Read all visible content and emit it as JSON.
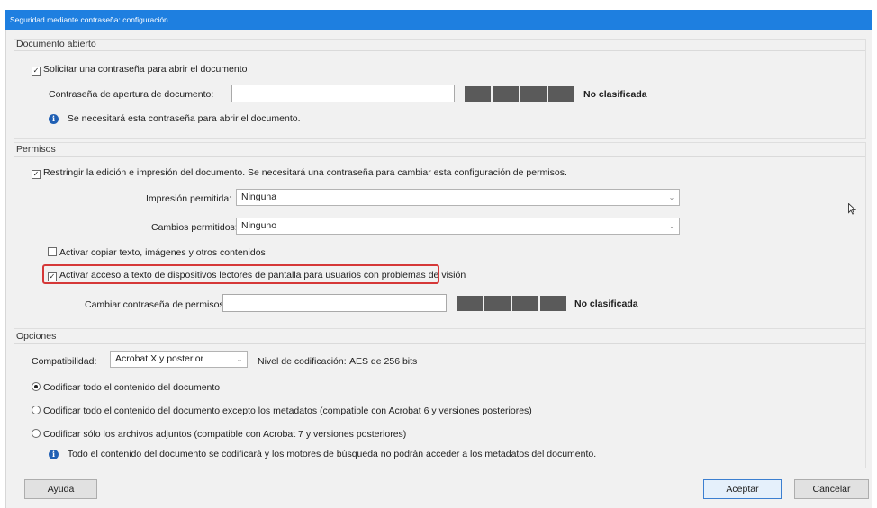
{
  "window": {
    "title": "Seguridad mediante contraseña: configuración"
  },
  "document_open": {
    "group_label": "Documento abierto",
    "require_password_label": "Solicitar una contraseña para abrir el documento",
    "require_password_checked": true,
    "password_label": "Contraseña de apertura de documento:",
    "password_value": "",
    "strength_label": "No clasificada",
    "info_text": "Se necesitará esta contraseña para abrir el documento."
  },
  "permissions": {
    "group_label": "Permisos",
    "restrict_label": "Restringir la edición e impresión del documento. Se necesitará una contraseña para cambiar esta configuración de permisos.",
    "restrict_checked": true,
    "printing_label": "Impresión permitida:",
    "printing_value": "Ninguna",
    "changes_label": "Cambios permitidos:",
    "changes_value": "Ninguno",
    "copy_label": "Activar copiar texto, imágenes y otros contenidos",
    "copy_checked": false,
    "screen_reader_label": "Activar acceso a texto de dispositivos lectores de pantalla para usuarios con problemas de visión",
    "screen_reader_checked": true,
    "change_password_label": "Cambiar contraseña de permisos:",
    "change_password_value": "",
    "strength_label": "No clasificada"
  },
  "options": {
    "group_label": "Opciones",
    "compat_label": "Compatibilidad:",
    "compat_value": "Acrobat X y posterior",
    "encryption_label": "Nivel de codificación:",
    "encryption_value": "AES de 256 bits",
    "radio_all": "Codificar todo el contenido del documento",
    "radio_except_metadata": "Codificar todo el contenido del documento excepto los metadatos (compatible con Acrobat 6 y versiones posteriores)",
    "radio_attachments": "Codificar sólo los archivos adjuntos (compatible con Acrobat 7 y versiones posteriores)",
    "selected": "radio_all",
    "info_text": "Todo el contenido del documento se codificará y los motores de búsqueda no podrán acceder a los metadatos del documento."
  },
  "buttons": {
    "help": "Ayuda",
    "ok": "Aceptar",
    "cancel": "Cancelar"
  },
  "icons": {
    "check": "✓",
    "info": "i",
    "dropdown": "chevron-down-icon",
    "cursor": "mouse-pointer-icon"
  },
  "colors": {
    "title_bar": "#1e7fe0",
    "highlight": "#d53838",
    "meter": "#5a5a5a"
  }
}
